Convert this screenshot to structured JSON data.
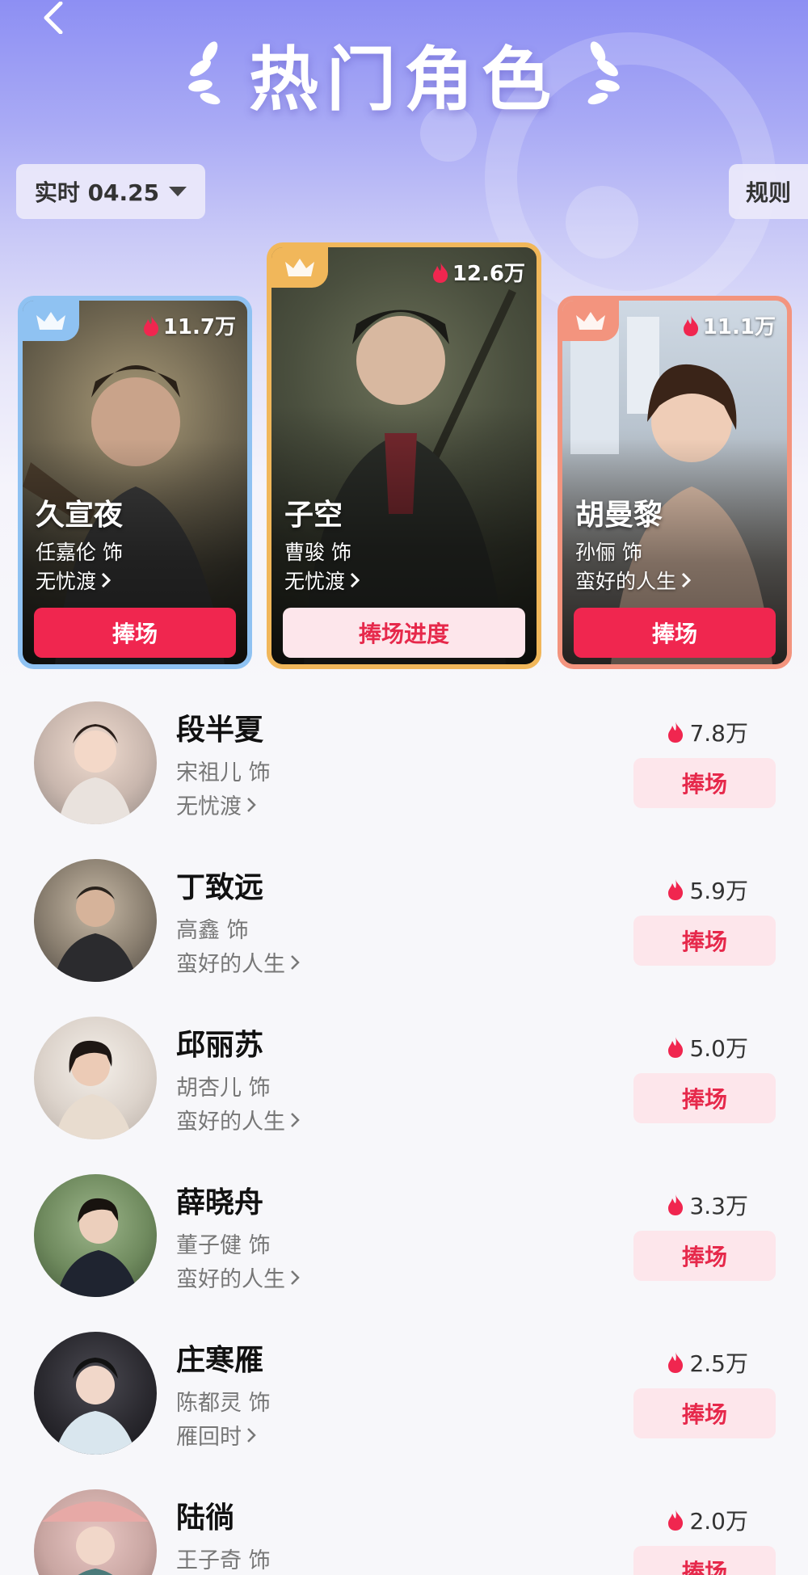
{
  "header": {
    "title": "热门角色",
    "date_label": "实时 04.25",
    "rules_label": "规则"
  },
  "top_cards": [
    {
      "character": "子空",
      "actor": "曹骏 饰",
      "show": "无忧渡",
      "heat": "12.6万",
      "button": "捧场进度",
      "rank": 1
    },
    {
      "character": "久宣夜",
      "actor": "任嘉伦 饰",
      "show": "无忧渡",
      "heat": "11.7万",
      "button": "捧场",
      "rank": 2
    },
    {
      "character": "胡曼黎",
      "actor": "孙俪 饰",
      "show": "蛮好的人生",
      "heat": "11.1万",
      "button": "捧场",
      "rank": 3
    }
  ],
  "list": [
    {
      "character": "段半夏",
      "actor": "宋祖儿 饰",
      "show": "无忧渡",
      "heat": "7.8万",
      "button": "捧场"
    },
    {
      "character": "丁致远",
      "actor": "高鑫 饰",
      "show": "蛮好的人生",
      "heat": "5.9万",
      "button": "捧场"
    },
    {
      "character": "邱丽苏",
      "actor": "胡杏儿 饰",
      "show": "蛮好的人生",
      "heat": "5.0万",
      "button": "捧场"
    },
    {
      "character": "薛晓舟",
      "actor": "董子健 饰",
      "show": "蛮好的人生",
      "heat": "3.3万",
      "button": "捧场"
    },
    {
      "character": "庄寒雁",
      "actor": "陈都灵 饰",
      "show": "雁回时",
      "heat": "2.5万",
      "button": "捧场"
    },
    {
      "character": "陆徜",
      "actor": "王子奇 饰",
      "show": "",
      "heat": "2.0万",
      "button": "捧场"
    }
  ],
  "colors": {
    "accent": "#f0264f",
    "gold": "#f1b75a",
    "silver_blue": "#8fc2f2",
    "bronze": "#f3947e",
    "button_soft": "#fde6eb"
  },
  "icons": {
    "back": "chevron-left-icon",
    "heat": "flame-icon",
    "crown": "crown-icon",
    "more": "chevron-right-icon",
    "dropdown": "triangle-down-icon"
  }
}
